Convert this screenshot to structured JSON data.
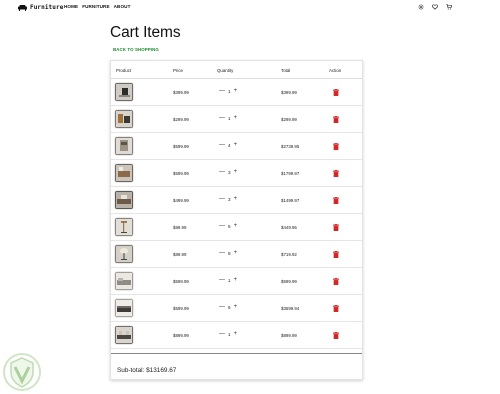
{
  "brand": {
    "name": "Furniture"
  },
  "nav": {
    "links": [
      "HOME",
      "FURNITURE",
      "ABOUT"
    ]
  },
  "icons": {
    "brand": "sofa-icon",
    "settings": "gear-icon",
    "wishlist": "heart-icon",
    "cart": "cart-icon",
    "delete": "trash-icon",
    "watermark": "shield-logo-icon"
  },
  "colors": {
    "accent_green": "#1a8a2a",
    "delete_red": "#d32626",
    "text": "#111111"
  },
  "page": {
    "title": "Cart Items",
    "back_link": "BACK TO SHOPPING"
  },
  "table": {
    "headers": {
      "product": "Product",
      "price": "Price",
      "quantity": "Quantity",
      "total": "Total",
      "action": "Action"
    },
    "rows": [
      {
        "price": "$399.99",
        "qty": "1",
        "total": "$399.99"
      },
      {
        "price": "$299.99",
        "qty": "1",
        "total": "$299.99"
      },
      {
        "price": "$599.99",
        "qty": "4",
        "total": "$2739.95"
      },
      {
        "price": "$599.99",
        "qty": "3",
        "total": "$1799.97"
      },
      {
        "price": "$499.99",
        "qty": "3",
        "total": "$1499.97"
      },
      {
        "price": "$89.99",
        "qty": "5",
        "total": "$449.95"
      },
      {
        "price": "$89.99",
        "qty": "8",
        "total": "$719.92"
      },
      {
        "price": "$599.99",
        "qty": "1",
        "total": "$599.99"
      },
      {
        "price": "$599.99",
        "qty": "6",
        "total": "$3599.94"
      },
      {
        "price": "$899.99",
        "qty": "1",
        "total": "$899.99"
      }
    ],
    "qty_minus": "—",
    "qty_plus": "+"
  },
  "summary": {
    "subtotal": "Sub-total: $13169.67"
  }
}
